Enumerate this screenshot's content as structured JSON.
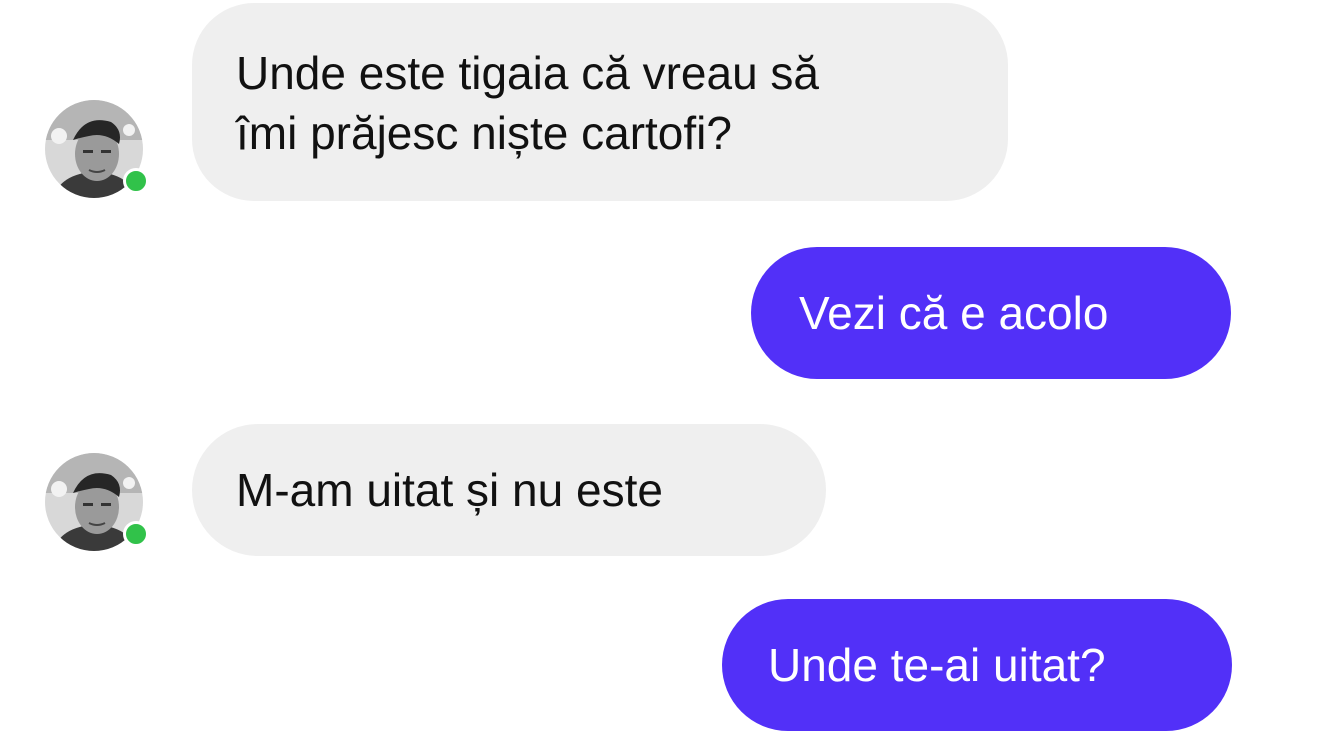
{
  "colors": {
    "incoming_bubble": "#efefef",
    "outgoing_bubble": "#5230f8",
    "online_indicator": "#31c24a"
  },
  "messages": [
    {
      "direction": "incoming",
      "text": "Unde este tigaia că vreau să\nîmi prăjesc niște cartofi?",
      "has_avatar": true
    },
    {
      "direction": "outgoing",
      "text": "Vezi că e acolo"
    },
    {
      "direction": "incoming",
      "text": "M-am uitat și nu este",
      "has_avatar": true
    },
    {
      "direction": "outgoing",
      "text": "Unde te-ai uitat?"
    }
  ]
}
